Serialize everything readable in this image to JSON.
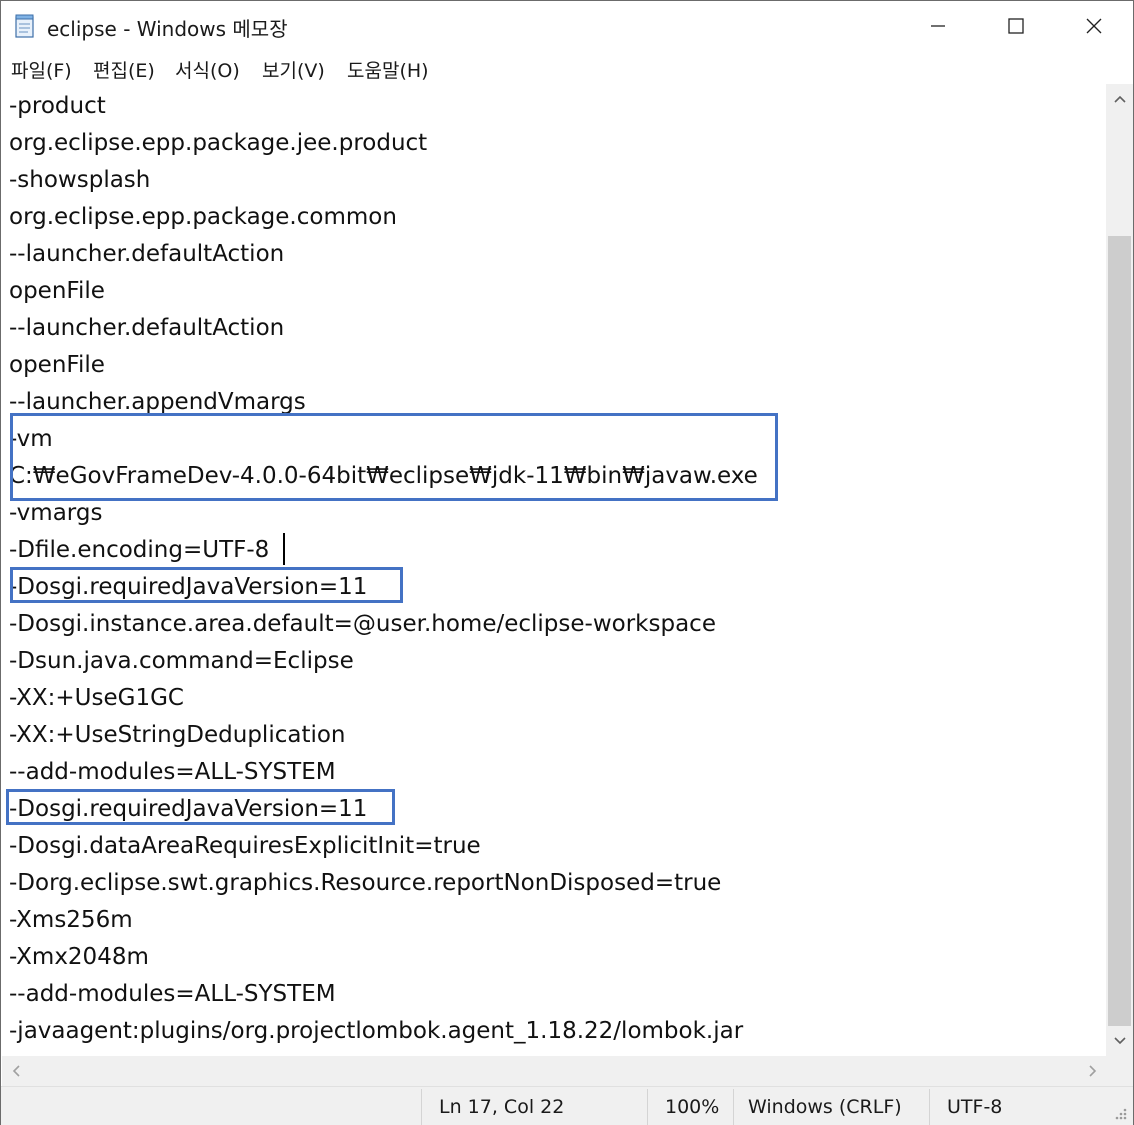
{
  "window": {
    "title": "eclipse - Windows 메모장",
    "icon": "notepad-icon"
  },
  "menu": {
    "items": [
      {
        "label": "파일(F)"
      },
      {
        "label": "편집(E)"
      },
      {
        "label": "서식(O)"
      },
      {
        "label": "보기(V)"
      },
      {
        "label": "도움말(H)"
      }
    ]
  },
  "editor": {
    "lines": [
      "-product",
      "org.eclipse.epp.package.jee.product",
      "-showsplash",
      "org.eclipse.epp.package.common",
      "--launcher.defaultAction",
      "openFile",
      "--launcher.defaultAction",
      "openFile",
      "--launcher.appendVmargs",
      "-vm",
      "C:₩eGovFrameDev-4.0.0-64bit₩eclipse₩jdk-11₩bin₩javaw.exe",
      "-vmargs",
      "-Dfile.encoding=UTF-8",
      "-Dosgi.requiredJavaVersion=11",
      "-Dosgi.instance.area.default=@user.home/eclipse-workspace",
      "-Dsun.java.command=Eclipse",
      "-XX:+UseG1GC",
      "-XX:+UseStringDeduplication",
      "--add-modules=ALL-SYSTEM",
      "-Dosgi.requiredJavaVersion=11",
      "-Dosgi.dataAreaRequiresExplicitInit=true",
      "-Dorg.eclipse.swt.graphics.Resource.reportNonDisposed=true",
      "-Xms256m",
      "-Xmx2048m",
      "--add-modules=ALL-SYSTEM",
      "-javaagent:plugins/org.projectlombok.agent_1.18.22/lombok.jar"
    ],
    "highlight_color": "#4472c4"
  },
  "status": {
    "position": "Ln 17, Col 22",
    "zoom": "100%",
    "line_ending": "Windows (CRLF)",
    "encoding": "UTF-8"
  }
}
